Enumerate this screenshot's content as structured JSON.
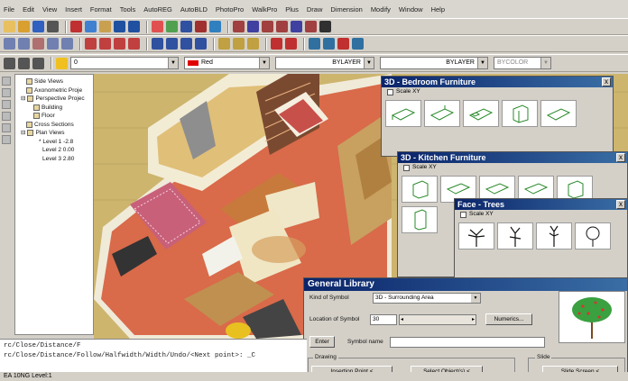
{
  "menu": [
    "File",
    "Edit",
    "View",
    "Insert",
    "Format",
    "Tools",
    "AutoREG",
    "AutoBLD",
    "PhotoPro",
    "WalkPro",
    "Plus",
    "Draw",
    "Dimension",
    "Modify",
    "Window",
    "Help"
  ],
  "toolbar3": {
    "layer": "0",
    "color": "Red",
    "linetype": "BYLAYER",
    "lineweight": "BYLAYER",
    "plotstyle": "BYCOLOR"
  },
  "tree": {
    "items": [
      "Side Views",
      "Axonometric Proje",
      "Perspective Projec",
      "Building",
      "Floor",
      "Cross Sections",
      "Plan Views",
      "* Level 1 -2.8",
      "Level 2 0.00",
      "Level 3 2.80"
    ]
  },
  "palettes": {
    "bedroom": {
      "title": "3D - Bedroom Furniture",
      "scale": "Scale XY",
      "close": "x"
    },
    "kitchen": {
      "title": "3D - Kitchen Furniture",
      "scale": "Scale XY",
      "close": "x"
    },
    "trees": {
      "title": "Face - Trees",
      "scale": "Scale XY",
      "close": "x"
    }
  },
  "general_library": {
    "title": "General Library",
    "close": "x",
    "kind_label": "Kind of Symbol",
    "kind_value": "3D - Surrounding Area",
    "location_label": "Location of Symbol",
    "location_value": "30",
    "numerics_button": "Numerics...",
    "enter_button": "Enter",
    "symbol_name_label": "Symbol name",
    "symbol_name_value": "",
    "drawing_group": "Drawing",
    "insertion_button": "Insertion Point <",
    "select_objects_button": "Select Object(s) <",
    "slide_group": "Slide",
    "slide_screen_button": "Slide Screen <"
  },
  "command_line": [
    "rc/Close/Distance/F",
    "rc/Close/Distance/Follow/Halfwidth/Width/Undo/<Next point>: _C"
  ],
  "status": "EA 10NG Level:1"
}
